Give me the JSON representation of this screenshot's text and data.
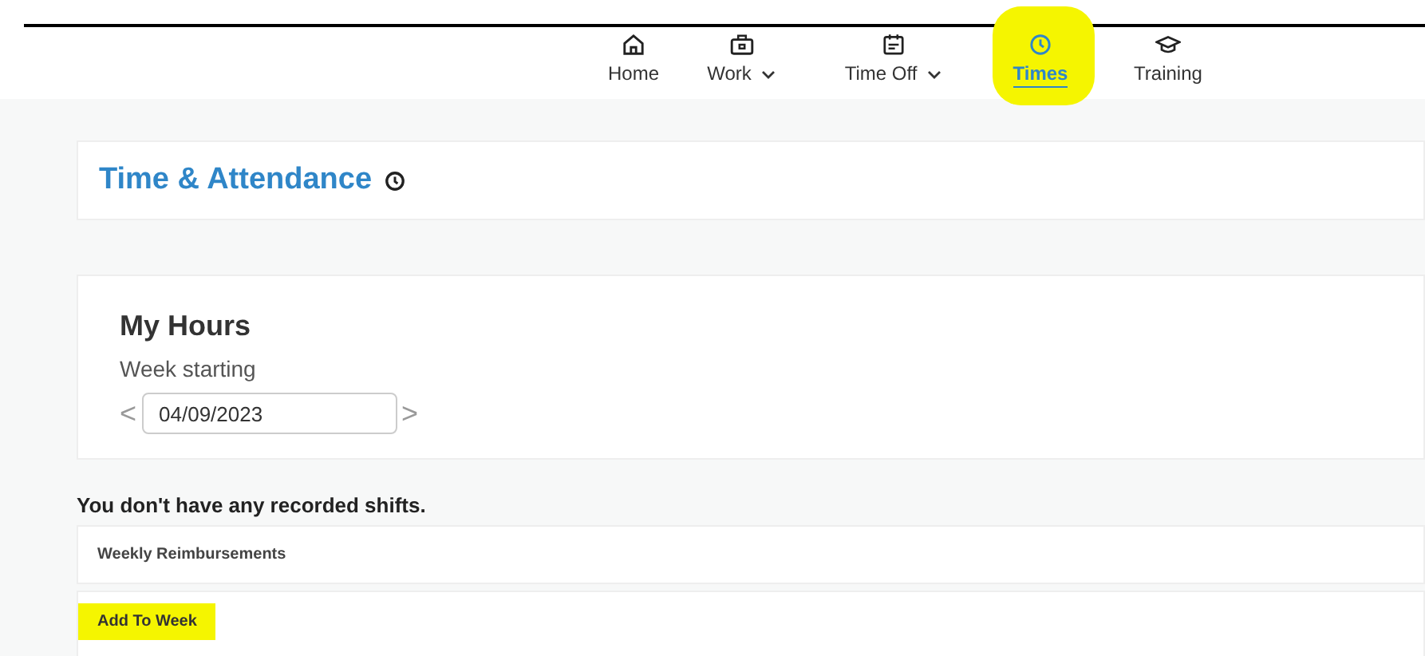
{
  "nav": [
    {
      "label": "Home",
      "selected": false,
      "dropdown": false,
      "highlighted": false
    },
    {
      "label": "Work",
      "selected": false,
      "dropdown": true,
      "highlighted": false
    },
    {
      "label": "Time Off",
      "selected": false,
      "dropdown": true,
      "highlighted": false
    },
    {
      "label": "Times",
      "selected": true,
      "dropdown": false,
      "highlighted": true
    },
    {
      "label": "Training",
      "selected": false,
      "dropdown": false,
      "highlighted": false
    }
  ],
  "page_title": "Time & Attendance",
  "my_hours": {
    "title": "My Hours",
    "label": "Week starting",
    "value": "04/09/2023",
    "prev": "<",
    "next": ">"
  },
  "message": "You don't have any recorded shifts.",
  "reimbursements": {
    "title": "Weekly Reimbursements"
  },
  "add_to_week": {
    "label": "Add To Week",
    "highlighted": true
  }
}
